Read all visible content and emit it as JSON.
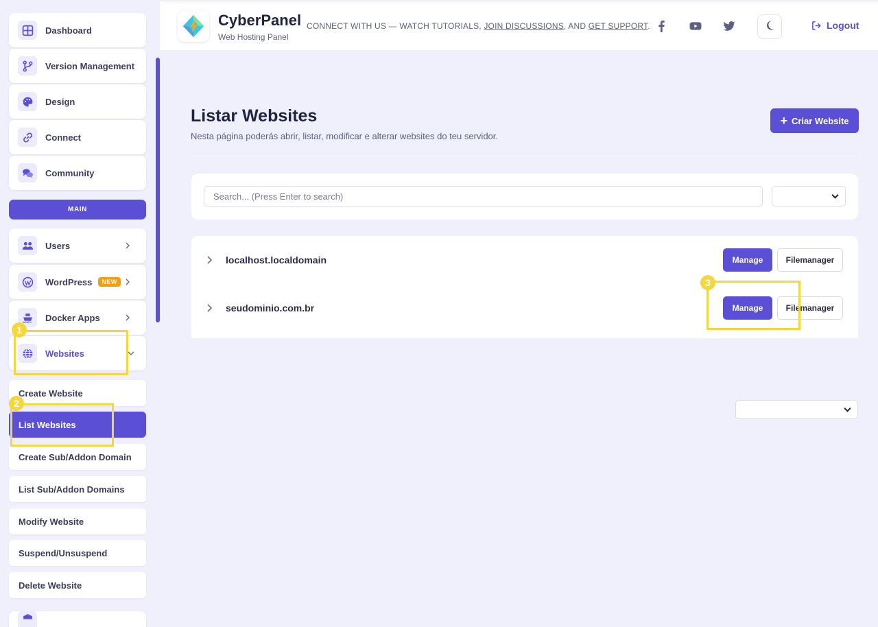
{
  "sidebar": {
    "top_items": [
      {
        "label": "Dashboard",
        "icon": "dashboard-icon"
      },
      {
        "label": "Version Management",
        "icon": "branch-icon"
      },
      {
        "label": "Design",
        "icon": "palette-icon"
      },
      {
        "label": "Connect",
        "icon": "link-icon"
      },
      {
        "label": "Community",
        "icon": "comments-icon"
      }
    ],
    "section_label": "MAIN",
    "main_items": [
      {
        "label": "Users",
        "icon": "users-icon"
      },
      {
        "label": "WordPress",
        "icon": "wordpress-icon",
        "badge": "NEW"
      },
      {
        "label": "Docker Apps",
        "icon": "docker-icon"
      },
      {
        "label": "Websites",
        "icon": "globe-icon"
      }
    ],
    "website_subitems": [
      {
        "label": "Create Website"
      },
      {
        "label": "List Websites",
        "active": true
      },
      {
        "label": "Create Sub/Addon Domain"
      },
      {
        "label": "List Sub/Addon Domains"
      },
      {
        "label": "Modify Website"
      },
      {
        "label": "Suspend/Unsuspend"
      },
      {
        "label": "Delete Website"
      }
    ]
  },
  "header": {
    "brand_title": "CyberPanel",
    "brand_subtitle": "Web Hosting Panel",
    "connect_prefix": "CONNECT WITH US — WATCH TUTORIALS, ",
    "connect_link1": "JOIN DISCUSSIONS",
    "connect_mid": ", AND ",
    "connect_link2": "GET SUPPORT",
    "connect_suffix": ".",
    "logout_label": "Logout"
  },
  "main": {
    "title": "Listar Websites",
    "description": "Nesta página poderás abrir, listar, modificar e alterar websites do teu servidor.",
    "create_button": "Criar Website",
    "search_placeholder": "Search... (Press Enter to search)",
    "websites": [
      {
        "domain": "localhost.localdomain",
        "manage": "Manage",
        "filemanager": "Filemanager"
      },
      {
        "domain": "seudominio.com.br",
        "manage": "Manage",
        "filemanager": "Filemanager"
      }
    ]
  },
  "annotations": {
    "markers": [
      "1",
      "2",
      "3"
    ],
    "color": "#f5d63d"
  },
  "colors": {
    "accent": "#5b4fd6",
    "background": "#f0effc",
    "badge": "#f59e0b"
  }
}
